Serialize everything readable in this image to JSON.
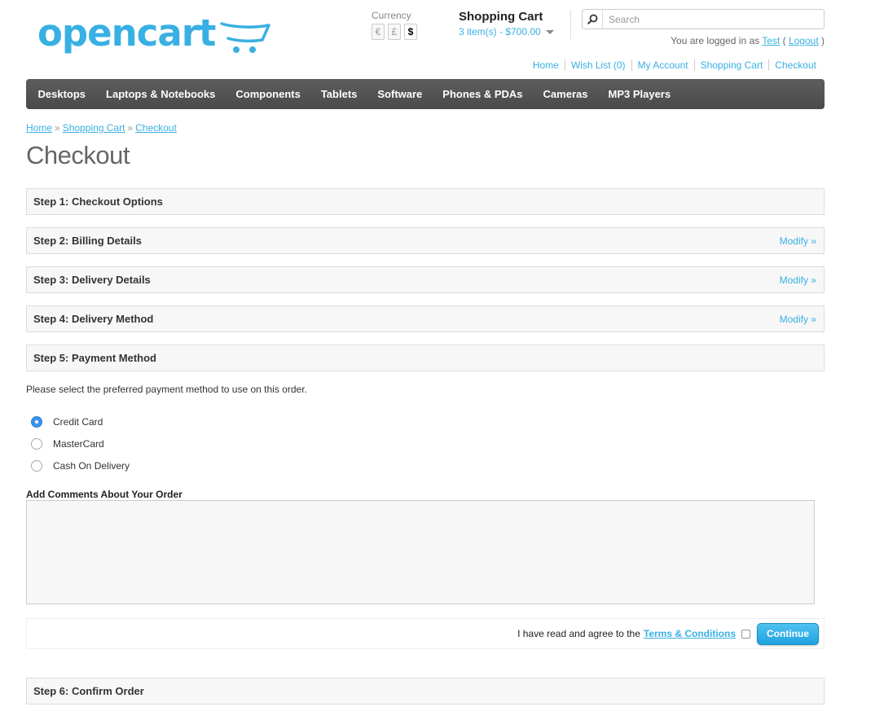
{
  "brand": {
    "logo_text": "opencart",
    "accent": "#38b0e3"
  },
  "currency": {
    "label": "Currency",
    "options": [
      "€",
      "£",
      "$"
    ],
    "selected": "$"
  },
  "cart": {
    "title": "Shopping Cart",
    "summary": "3 item(s) - $700.00"
  },
  "search": {
    "placeholder": "Search"
  },
  "account": {
    "prefix": "You are logged in as",
    "username": "Test",
    "open": "(",
    "logout": "Logout",
    "close": ")"
  },
  "top_links": [
    "Home",
    "Wish List (0)",
    "My Account",
    "Shopping Cart",
    "Checkout"
  ],
  "menu": [
    "Desktops",
    "Laptops & Notebooks",
    "Components",
    "Tablets",
    "Software",
    "Phones & PDAs",
    "Cameras",
    "MP3 Players"
  ],
  "breadcrumb": {
    "items": [
      "Home",
      "Shopping Cart",
      "Checkout"
    ],
    "separator": "»"
  },
  "page_title": "Checkout",
  "steps": [
    {
      "title": "Step 1: Checkout Options",
      "modify": ""
    },
    {
      "title": "Step 2: Billing Details",
      "modify": "Modify »"
    },
    {
      "title": "Step 3: Delivery Details",
      "modify": "Modify »"
    },
    {
      "title": "Step 4: Delivery Method",
      "modify": "Modify »"
    },
    {
      "title": "Step 5: Payment Method",
      "modify": ""
    },
    {
      "title": "Step 6: Confirm Order",
      "modify": ""
    }
  ],
  "payment": {
    "description": "Please select the preferred payment method to use on this order.",
    "methods": [
      {
        "label": "Credit Card",
        "checked": true
      },
      {
        "label": "MasterCard",
        "checked": false
      },
      {
        "label": "Cash On Delivery",
        "checked": false
      }
    ],
    "comments_label": "Add Comments About Your Order",
    "comments_value": "",
    "agree_text": "I have read and agree to the",
    "terms_link": "Terms & Conditions",
    "agree_checked": false,
    "continue_label": "Continue"
  }
}
